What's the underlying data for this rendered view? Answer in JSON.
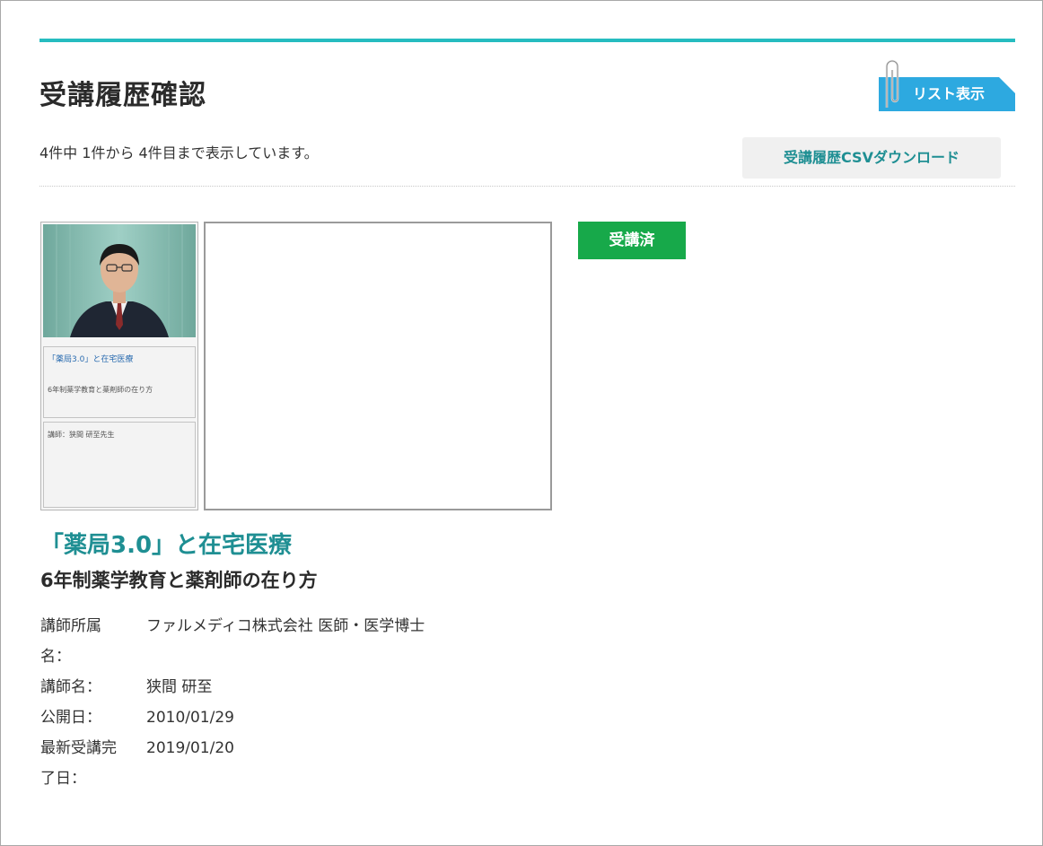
{
  "page": {
    "title": "受講履歴確認",
    "list_button": "リスト表示",
    "count_text": "4件中 1件から 4件目まで表示しています。",
    "csv_button": "受講履歴CSVダウンロード"
  },
  "course": {
    "thumb_title": "「薬局3.0」と在宅医療",
    "thumb_subtitle": "6年制薬学教育と薬剤師の在り方",
    "thumb_lecturer": "講師：狭間 研至先生",
    "status": "受講済",
    "title": "「薬局3.0」と在宅医療",
    "subtitle": "6年制薬学教育と薬剤師の在り方",
    "details": {
      "affiliation_label_line1": "講師所属",
      "affiliation_label_line2": "名：",
      "affiliation_value": "ファルメディコ株式会社 医師・医学博士",
      "lecturer_label": "講師名：",
      "lecturer_value": "狭間 研至",
      "published_label": "公開日：",
      "published_value": "2010/01/29",
      "completed_label_line1": "最新受講完",
      "completed_label_line2": "了日：",
      "completed_value": "2019/01/20"
    }
  },
  "colors": {
    "accent": "#26bcc0",
    "teal_text": "#1f8f93",
    "list_button": "#2da9e0",
    "status_green": "#17a94a"
  }
}
